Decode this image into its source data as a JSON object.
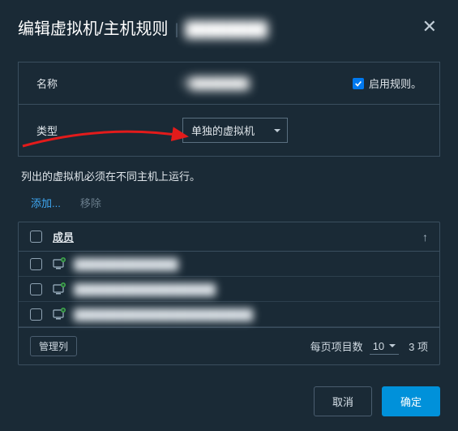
{
  "header": {
    "title": "编辑虚拟机/主机规则",
    "context_name": "████████",
    "close_aria": "Close"
  },
  "form": {
    "name_label": "名称",
    "name_value": "P████████",
    "enable_label": "启用规则。",
    "enable_checked": true,
    "type_label": "类型",
    "type_value": "单独的虚拟机"
  },
  "description": "列出的虚拟机必须在不同主机上运行。",
  "actions": {
    "add": "添加...",
    "remove": "移除"
  },
  "table": {
    "col_member": "成员",
    "sort_icon": "↑",
    "rows": [
      {
        "name": "██████████████"
      },
      {
        "name": "███████████████████"
      },
      {
        "name": "████████████████████████"
      }
    ]
  },
  "tfoot": {
    "manage_cols": "管理列",
    "per_page_label": "每页项目数",
    "per_page_value": "10",
    "count": "3 项"
  },
  "footer": {
    "cancel": "取消",
    "ok": "确定"
  }
}
